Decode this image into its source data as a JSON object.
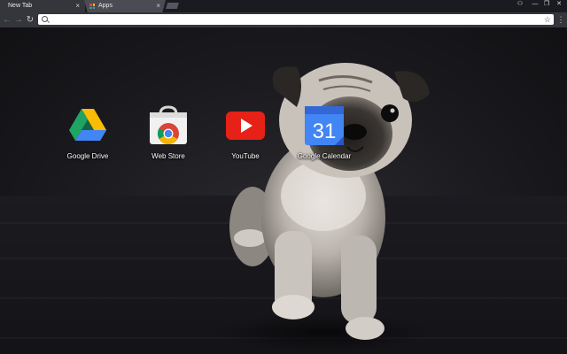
{
  "tabs": [
    {
      "label": "New Tab",
      "close": "×",
      "active": true
    },
    {
      "label": "Apps",
      "close": "×",
      "active": false
    }
  ],
  "window_controls": {
    "profile": "⚇",
    "minimize": "—",
    "restore": "❐",
    "close": "✕"
  },
  "toolbar": {
    "back": "←",
    "forward": "→",
    "reload": "↻",
    "omnibox_value": "",
    "star": "☆",
    "menu": "⋮"
  },
  "apps": [
    {
      "label": "Google Drive",
      "icon": "google-drive-icon"
    },
    {
      "label": "Web Store",
      "icon": "chrome-web-store-icon"
    },
    {
      "label": "YouTube",
      "icon": "youtube-icon"
    },
    {
      "label": "Google Calendar",
      "icon": "google-calendar-icon",
      "day": "31"
    }
  ],
  "colors": {
    "tabstrip": "#1a1b21",
    "toolbar": "#35363b",
    "youtube_red": "#e62117",
    "calendar_blue": "#4285f4"
  }
}
